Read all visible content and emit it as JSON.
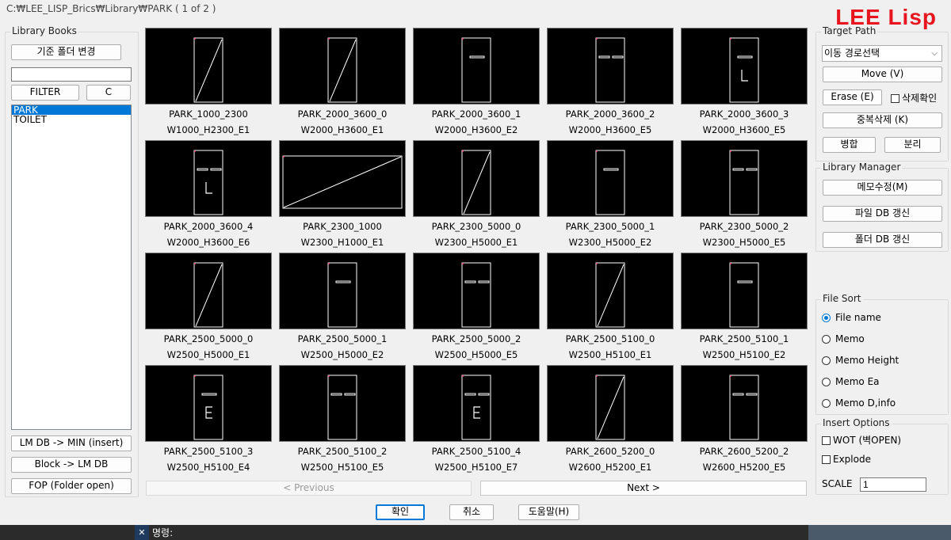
{
  "window": {
    "title": "C:₩LEE_LISP_Brics₩Library₩PARK   ( 1 of 2 )",
    "brand": "LEE Lisp"
  },
  "library_books": {
    "label": "Library Books",
    "base_folder_button": "기준 폴더 변경",
    "filter_value": "",
    "filter_button": "FILTER",
    "clear_button": "C",
    "items": [
      {
        "label": "PARK",
        "selected": true
      },
      {
        "label": "TOILET",
        "selected": false
      }
    ],
    "lm_db_min_button": "LM DB -> MIN (insert)",
    "block_lm_db_button": "Block -> LM DB",
    "fop_button": "FOP (Folder open)"
  },
  "thumbnails": [
    {
      "name": "PARK_1000_2300",
      "memo": "W1000_H2300_E1",
      "icon": "door-diagonal"
    },
    {
      "name": "PARK_2000_3600_0",
      "memo": "W2000_H3600_E1",
      "icon": "door-diagonal"
    },
    {
      "name": "PARK_2000_3600_1",
      "memo": "W2000_H3600_E2",
      "icon": "door-one-bar"
    },
    {
      "name": "PARK_2000_3600_2",
      "memo": "W2000_H3600_E5",
      "icon": "door-two-bars"
    },
    {
      "name": "PARK_2000_3600_3",
      "memo": "W2000_H3600_E5",
      "icon": "door-bar-L"
    },
    {
      "name": "PARK_2000_3600_4",
      "memo": "W2000_H3600_E6",
      "icon": "door-two-bars-L"
    },
    {
      "name": "PARK_2300_1000",
      "memo": "W2300_H1000_E1",
      "icon": "wide-diagonal"
    },
    {
      "name": "PARK_2300_5000_0",
      "memo": "W2300_H5000_E1",
      "icon": "door-diagonal"
    },
    {
      "name": "PARK_2300_5000_1",
      "memo": "W2300_H5000_E2",
      "icon": "door-one-bar"
    },
    {
      "name": "PARK_2300_5000_2",
      "memo": "W2300_H5000_E5",
      "icon": "door-two-bars"
    },
    {
      "name": "PARK_2500_5000_0",
      "memo": "W2500_H5000_E1",
      "icon": "door-diagonal"
    },
    {
      "name": "PARK_2500_5000_1",
      "memo": "W2500_H5000_E2",
      "icon": "door-one-bar"
    },
    {
      "name": "PARK_2500_5000_2",
      "memo": "W2500_H5000_E5",
      "icon": "door-two-bars"
    },
    {
      "name": "PARK_2500_5100_0",
      "memo": "W2500_H5100_E1",
      "icon": "door-diagonal"
    },
    {
      "name": "PARK_2500_5100_1",
      "memo": "W2500_H5100_E2",
      "icon": "door-one-bar"
    },
    {
      "name": "PARK_2500_5100_3",
      "memo": "W2500_H5100_E4",
      "icon": "door-bar-E"
    },
    {
      "name": "PARK_2500_5100_2",
      "memo": "W2500_H5100_E5",
      "icon": "door-two-bars"
    },
    {
      "name": "PARK_2500_5100_4",
      "memo": "W2500_H5100_E7",
      "icon": "door-two-bars-E"
    },
    {
      "name": "PARK_2600_5200_0",
      "memo": "W2600_H5200_E1",
      "icon": "door-diagonal"
    },
    {
      "name": "PARK_2600_5200_2",
      "memo": "W2600_H5200_E5",
      "icon": "door-two-bars"
    }
  ],
  "nav": {
    "previous": "< Previous",
    "next": "Next >"
  },
  "target_path": {
    "label": "Target Path",
    "select_value": "이동 경로선택",
    "move_button": "Move (V)",
    "erase_button": "Erase (E)",
    "delete_confirm_label": "삭제확인",
    "dup_delete_button": "중복삭제 (K)",
    "merge_button": "병합",
    "split_button": "분리"
  },
  "library_manager": {
    "label": "Library Manager",
    "memo_edit_button": "메모수정(M)",
    "file_db_button": "파일 DB 갱신",
    "folder_db_button": "폴더 DB 갱신"
  },
  "file_sort": {
    "label": "File Sort",
    "options": [
      "File name",
      "Memo",
      "Memo Height",
      "Memo Ea",
      "Memo D,info"
    ],
    "selected_index": 0
  },
  "insert_options": {
    "label": "Insert Options",
    "wot_label": "WOT (벽OPEN)",
    "explode_label": "Explode",
    "scale_label": "SCALE",
    "scale_value": "1"
  },
  "footer": {
    "ok": "확인",
    "cancel": "취소",
    "help": "도움말(H)"
  },
  "command_line": {
    "prompt": "명령:"
  },
  "colors": {
    "accent": "#0078d7",
    "brand": "#e8141e",
    "thumb_bg": "#000000",
    "thumb_line": "#ffffff"
  }
}
